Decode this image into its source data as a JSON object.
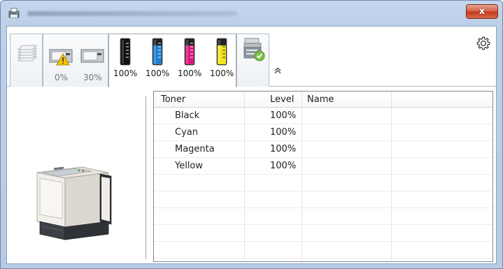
{
  "window": {
    "close_label": "x",
    "close_color": "#c94a32"
  },
  "toolbar": {
    "paper_tray_icon": "paper-stack-icon",
    "tray_1": {
      "icon": "tray-warning-icon",
      "level": "0%"
    },
    "tray_2": {
      "icon": "tray-icon",
      "level": "30%"
    },
    "toners": [
      {
        "name": "Black",
        "level": "100%",
        "color": "#111111"
      },
      {
        "name": "Cyan",
        "level": "100%",
        "color": "#1f7fd0"
      },
      {
        "name": "Magenta",
        "level": "100%",
        "color": "#d81b7f"
      },
      {
        "name": "Yellow",
        "level": "100%",
        "color": "#f2e21c"
      }
    ],
    "device_icon": "printer-ok-icon",
    "settings_icon": "gear-icon",
    "collapse_icon": "chevron-up-icon"
  },
  "table": {
    "columns": [
      "Toner",
      "Level",
      "Name"
    ],
    "rows": [
      {
        "toner": "Black",
        "level": "100%",
        "name": ""
      },
      {
        "toner": "Cyan",
        "level": "100%",
        "name": ""
      },
      {
        "toner": "Magenta",
        "level": "100%",
        "name": ""
      },
      {
        "toner": "Yellow",
        "level": "100%",
        "name": ""
      }
    ]
  }
}
